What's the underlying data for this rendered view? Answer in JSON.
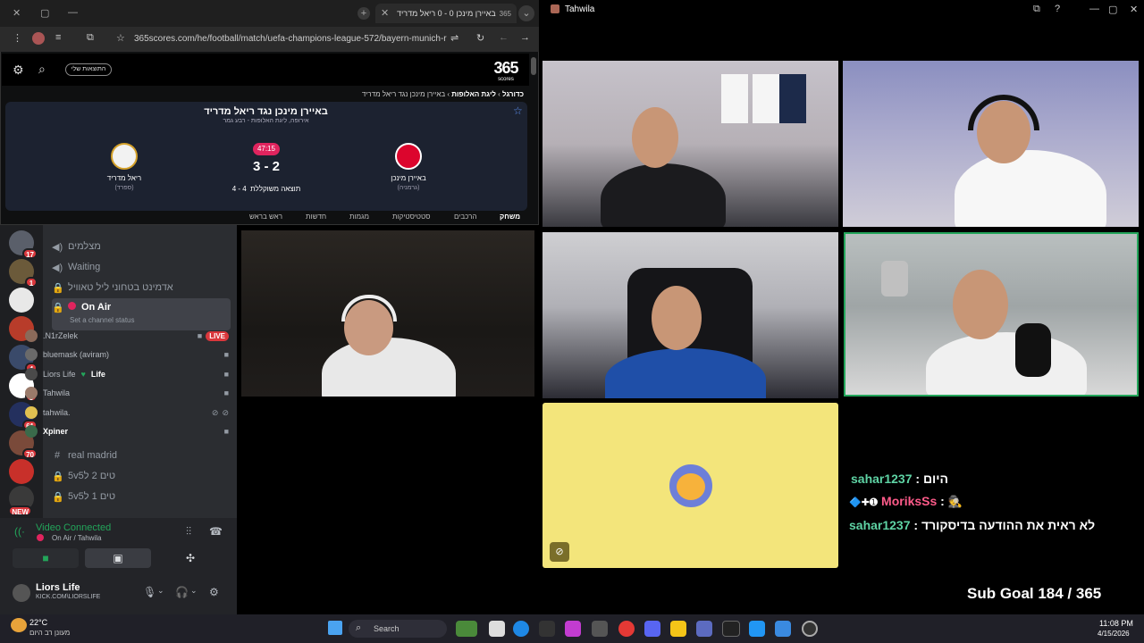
{
  "browser": {
    "tab_title": "באיירן מינכן 0 - 0 ריאל מדריד",
    "url": "365scores.com/he/football/match/uefa-champions-league-572/bayern-munich-re...",
    "site_logo": "365",
    "site_logo_sub": "scores",
    "my_results": "התוצאות שלי",
    "breadcrumb": [
      "כדורגל",
      "ליגת האלופות",
      "באיירן מינכן נגד ריאל מדריד"
    ],
    "match_title": "באיירן מינכן נגד ריאל מדריד",
    "match_subtitle": "אירופה, ליגת האלופות - רבע גמר",
    "live_time": "47:15",
    "score": "3 - 2",
    "aggregate_label": "תוצאה משוקללת",
    "aggregate_score": "4 - 4",
    "home_team": {
      "name": "באיירן מינכן",
      "country": "(גרמניה)"
    },
    "away_team": {
      "name": "ריאל מדריד",
      "country": "(ספרד)"
    },
    "nav_tabs": [
      "משחק",
      "הרכבים",
      "סטטיסטיקות",
      "מגמות",
      "חדשות",
      "ראש בראש"
    ]
  },
  "discord": {
    "channels": [
      {
        "label": "מצלמים",
        "icon": "speaker-icon"
      },
      {
        "label": "Waiting",
        "icon": "speaker-icon"
      },
      {
        "label": "אדמינט בטחוני ליל טאוויל",
        "icon": "lock-icon"
      }
    ],
    "active_channel": {
      "label": "On Air",
      "status": "Set a channel status"
    },
    "members": [
      {
        "name": ".N1rZelek",
        "live": "LIVE"
      },
      {
        "name": "bluemask (aviram)"
      },
      {
        "name": "Liors Life",
        "tag": "Life"
      },
      {
        "name": "Tahwila"
      },
      {
        "name": "tahwila."
      },
      {
        "name": "Xpiner"
      }
    ],
    "more_channels": [
      "real madrid",
      "5vטים 2 ל5",
      "5vטים 1 ל5"
    ],
    "server_badges": [
      "17",
      "1",
      "",
      "",
      "4",
      "5",
      "61",
      "70",
      "",
      "NEW"
    ],
    "voice_status": "Video Connected",
    "voice_location": "On Air / Tahwila",
    "user_name": "Liors Life",
    "user_tag": "KICK.COM\\LIORSLIFE"
  },
  "stream": {
    "window_title": "Tahwila"
  },
  "chat": [
    {
      "user": "sahar1237",
      "message": "היום"
    },
    {
      "user": "MoriksSs",
      "message": ""
    },
    {
      "user": "sahar1237",
      "message": "לא ראית את ההודעה בדיסקורד"
    }
  ],
  "sub_goal": "Sub Goal 184 / 365",
  "taskbar": {
    "temperature": "22°C",
    "weather": "מעונן רב היום",
    "search_placeholder": "Search",
    "time": "11:08 PM",
    "date": "4/15/2026"
  },
  "colors": {
    "accent_green": "#23a55a",
    "live_red": "#da373c",
    "score_pill": "#e0245e",
    "yellow_tile": "#f3e57b"
  }
}
